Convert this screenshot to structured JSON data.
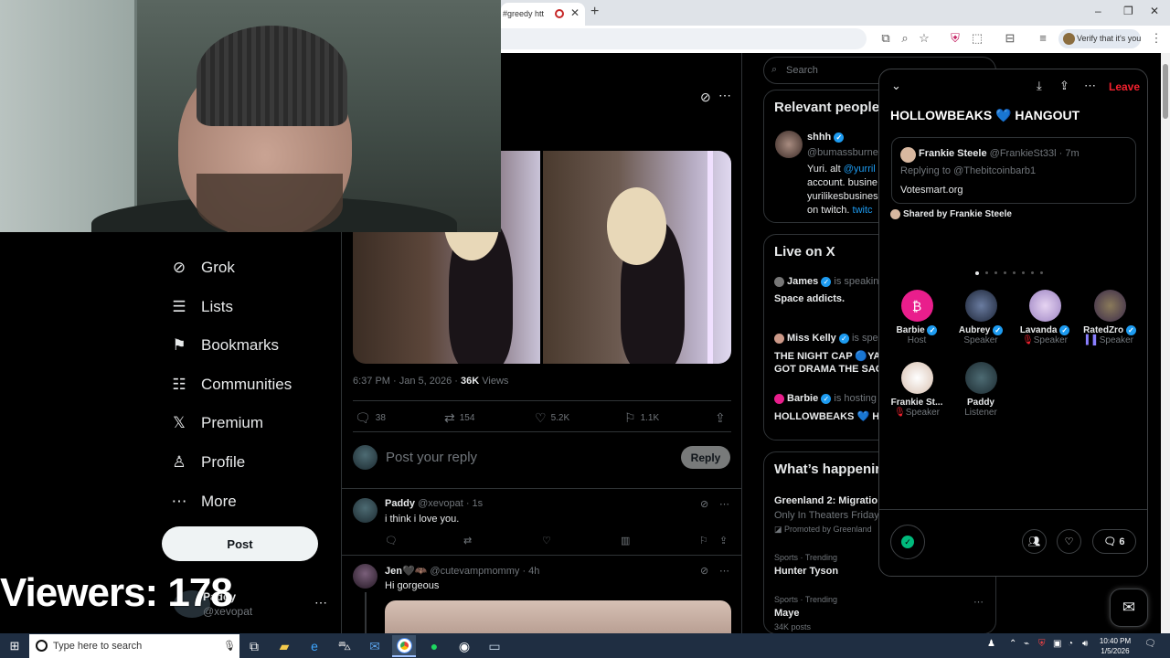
{
  "browser": {
    "tab_title": "#greedy htt",
    "new_tab": "+",
    "verify_label": "Verify that it's you",
    "window_minimize": "–",
    "window_restore": "❐",
    "window_close": "✕"
  },
  "left_nav": {
    "items": [
      {
        "label": "Grok",
        "icon": "grok-icon"
      },
      {
        "label": "Lists",
        "icon": "lists-icon"
      },
      {
        "label": "Bookmarks",
        "icon": "bookmark-icon"
      },
      {
        "label": "Communities",
        "icon": "communities-icon"
      },
      {
        "label": "Premium",
        "icon": "x-logo-icon"
      },
      {
        "label": "Profile",
        "icon": "profile-icon"
      },
      {
        "label": "More",
        "icon": "more-circle-icon"
      }
    ],
    "post_label": "Post",
    "account_name": "Paddy",
    "account_handle": "@xevopat"
  },
  "overlay": {
    "viewers": "Viewers: 178"
  },
  "post": {
    "time": "6:37 PM · Jan 5, 2026 · ",
    "views_count": "36K",
    "views_label": " Views",
    "replies": "38",
    "reposts": "154",
    "likes": "5.2K",
    "bookmarks": "1.1K",
    "reply_placeholder": "Post your reply",
    "reply_button": "Reply"
  },
  "replies": [
    {
      "name": "Paddy",
      "handle": "@xevopat · 1s",
      "text": "i think i love you."
    },
    {
      "name": "Jen🖤🦇",
      "handle": "@cutevampmommy · 4h",
      "text": "Hi gorgeous"
    }
  ],
  "right": {
    "search_placeholder": "Search",
    "relevant_title": "Relevant people",
    "relevant_person": {
      "name": "shhh",
      "handle": "@bumassburne",
      "bio_1": "Yuri. alt ",
      "bio_link": "@yurril",
      "bio_2": "account. busine",
      "bio_3": "yurilikesbusines",
      "bio_4": "on twitch. ",
      "bio_link2": "twitc"
    },
    "live_title": "Live on X",
    "live": [
      {
        "host": "James",
        "status": "is speaking",
        "title": "Space addicts."
      },
      {
        "host": "Miss Kelly",
        "status": "is speak",
        "title": "THE NIGHT CAP 🔵YA",
        "title2": "GOT DRAMA THE SAG"
      },
      {
        "host": "Barbie",
        "status": "is hosting",
        "title": "HOLLOWBEAKS 💙 HA"
      }
    ],
    "happening_title": "What’s happenin",
    "trends": [
      {
        "title": "Greenland 2: Migratio",
        "sub": "Only In Theaters Friday",
        "promo": "Promoted by Greenland"
      },
      {
        "category": "Sports · Trending",
        "title": "Hunter Tyson"
      },
      {
        "category": "Sports · Trending",
        "title": "Maye",
        "count": "34K posts"
      }
    ]
  },
  "space": {
    "leave": "Leave",
    "title": "HOLLOWBEAKS 💙 HANGOUT",
    "quote_author": "Frankie Steele",
    "quote_handle": "@FrankieSt33l · 7m",
    "quote_replying": "Replying to @Thebitcoinbarb1",
    "quote_text": "Votesmart.org",
    "shared_by": "Shared by Frankie Steele",
    "speakers": [
      {
        "name": "Barbie",
        "role": "Host",
        "color": "#e91e8c"
      },
      {
        "name": "Aubrey",
        "role": "Speaker",
        "color": "#3a4a66"
      },
      {
        "name": "Lavanda",
        "role": "Speaker",
        "color": "#b9a3d6"
      },
      {
        "name": "RatedZro",
        "role": "Speaker",
        "color": "#5a4a6a"
      },
      {
        "name": "Frankie St...",
        "role": "Speaker",
        "color": "#e8d0c0"
      },
      {
        "name": "Paddy",
        "role": "Listener",
        "color": "#33474f"
      }
    ],
    "reply_count": "6"
  },
  "taskbar": {
    "search_placeholder": "Type here to search",
    "time": "10:40 PM",
    "date": "1/5/2026"
  },
  "colors": {
    "accent": "#1d9bf0",
    "leave": "#f4212e",
    "mic_on": "#00ba7c"
  }
}
